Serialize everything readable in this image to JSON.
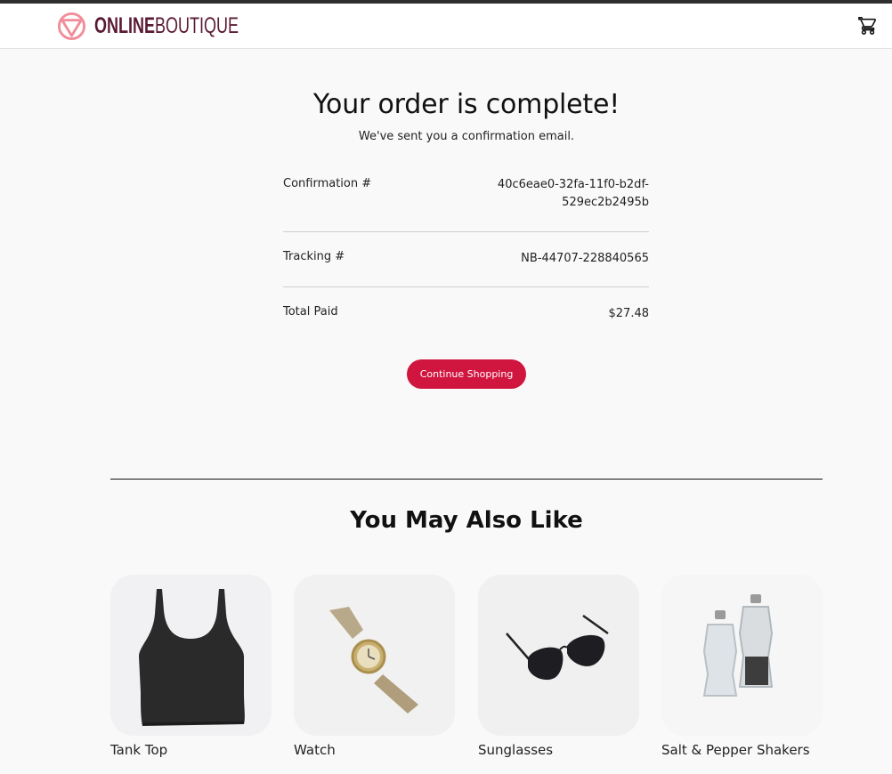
{
  "header": {
    "logo_bold": "ONLINE",
    "logo_light": "BOUTIQUE",
    "cart_icon": "shopping-cart-icon",
    "brand_color": "#5a1a33",
    "logo_mark_color": "#f08e9a"
  },
  "order": {
    "title": "Your order is complete!",
    "subtitle": "We've sent you a confirmation email.",
    "confirmation_label": "Confirmation #",
    "confirmation_value": "40c6eae0-32fa-11f0-b2df-529ec2b2495b",
    "tracking_label": "Tracking #",
    "tracking_value": "NB-44707-228840565",
    "total_label": "Total Paid",
    "total_value": "$27.48",
    "continue_label": "Continue Shopping",
    "accent_color": "#d0153e"
  },
  "recommendations": {
    "title": "You May Also Like",
    "items": [
      {
        "name": "Tank Top",
        "icon": "tank-top-image"
      },
      {
        "name": "Watch",
        "icon": "watch-image"
      },
      {
        "name": "Sunglasses",
        "icon": "sunglasses-image"
      },
      {
        "name": "Salt & Pepper Shakers",
        "icon": "salt-pepper-shakers-image"
      }
    ]
  }
}
